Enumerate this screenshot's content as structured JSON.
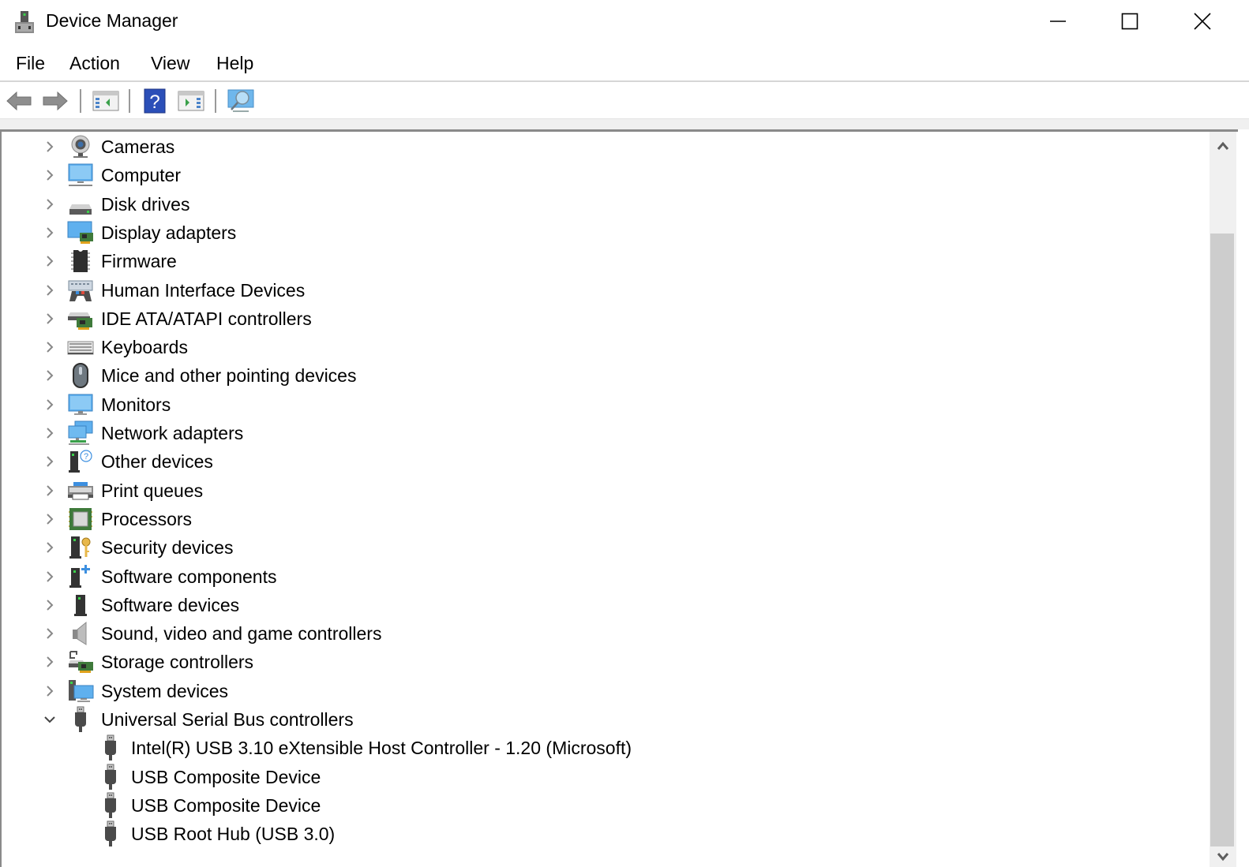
{
  "window": {
    "title": "Device Manager",
    "controls": {
      "minimize": "minimize",
      "maximize": "maximize",
      "close": "close"
    }
  },
  "menu": {
    "items": [
      {
        "label": "File"
      },
      {
        "label": "Action"
      },
      {
        "label": "View"
      },
      {
        "label": "Help"
      }
    ]
  },
  "toolbar": {
    "buttons": [
      {
        "name": "back",
        "icon": "arrow-left-icon"
      },
      {
        "name": "forward",
        "icon": "arrow-right-icon"
      },
      {
        "name": "show-hide-console-tree",
        "icon": "console-tree-icon"
      },
      {
        "name": "help",
        "icon": "help-icon"
      },
      {
        "name": "show-hide-action-pane",
        "icon": "action-pane-icon"
      },
      {
        "name": "scan-hardware-changes",
        "icon": "scan-monitor-icon"
      }
    ]
  },
  "tree": {
    "categories": [
      {
        "label": "Cameras",
        "icon": "camera-icon",
        "expanded": false
      },
      {
        "label": "Computer",
        "icon": "computer-icon",
        "expanded": false
      },
      {
        "label": "Disk drives",
        "icon": "disk-drive-icon",
        "expanded": false
      },
      {
        "label": "Display adapters",
        "icon": "display-adapter-icon",
        "expanded": false
      },
      {
        "label": "Firmware",
        "icon": "firmware-chip-icon",
        "expanded": false
      },
      {
        "label": "Human Interface Devices",
        "icon": "hid-icon",
        "expanded": false
      },
      {
        "label": "IDE ATA/ATAPI controllers",
        "icon": "ide-controller-icon",
        "expanded": false
      },
      {
        "label": "Keyboards",
        "icon": "keyboard-icon",
        "expanded": false
      },
      {
        "label": "Mice and other pointing devices",
        "icon": "mouse-icon",
        "expanded": false
      },
      {
        "label": "Monitors",
        "icon": "monitor-icon",
        "expanded": false
      },
      {
        "label": "Network adapters",
        "icon": "network-adapter-icon",
        "expanded": false
      },
      {
        "label": "Other devices",
        "icon": "other-device-icon",
        "expanded": false
      },
      {
        "label": "Print queues",
        "icon": "printer-icon",
        "expanded": false
      },
      {
        "label": "Processors",
        "icon": "processor-icon",
        "expanded": false
      },
      {
        "label": "Security devices",
        "icon": "security-device-icon",
        "expanded": false
      },
      {
        "label": "Software components",
        "icon": "software-component-icon",
        "expanded": false
      },
      {
        "label": "Software devices",
        "icon": "software-device-icon",
        "expanded": false
      },
      {
        "label": "Sound, video and game controllers",
        "icon": "speaker-icon",
        "expanded": false
      },
      {
        "label": "Storage controllers",
        "icon": "storage-controller-icon",
        "expanded": false
      },
      {
        "label": "System devices",
        "icon": "system-device-icon",
        "expanded": false
      },
      {
        "label": "Universal Serial Bus controllers",
        "icon": "usb-icon",
        "expanded": true
      }
    ],
    "usb_children": [
      {
        "label": "Intel(R) USB 3.10 eXtensible Host Controller - 1.20 (Microsoft)",
        "icon": "usb-icon"
      },
      {
        "label": "USB Composite Device",
        "icon": "usb-icon"
      },
      {
        "label": "USB Composite Device",
        "icon": "usb-icon"
      },
      {
        "label": "USB Root Hub (USB 3.0)",
        "icon": "usb-icon"
      }
    ]
  },
  "scrollbar": {
    "position_fraction": 0.12,
    "visible_fraction": 0.86
  },
  "colors": {
    "accent_blue": "#3c8fe0",
    "help_blue": "#2b4fb8",
    "chip_green": "#3f7a3b",
    "led_green": "#3bd14a"
  }
}
